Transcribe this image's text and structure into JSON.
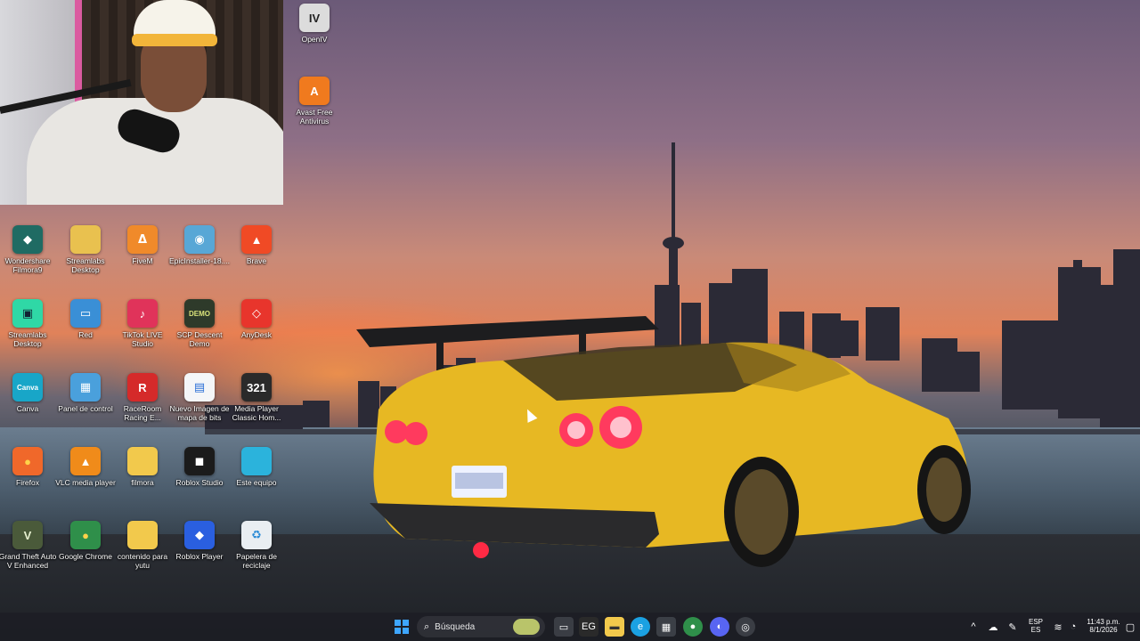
{
  "desktop_icons": [
    {
      "id": "openiv",
      "label": "OpenIV",
      "glyph": "IV",
      "color": "#dcdcdc",
      "text": "#222"
    },
    {
      "id": "avast",
      "label": "Avast Free Antivirus",
      "glyph": "A",
      "color": "#f07a1e",
      "text": "#fff"
    },
    {
      "id": "filmora",
      "label": "Wondershare Filmora9",
      "glyph": "◆",
      "color": "#1f6b63",
      "text": "#fff"
    },
    {
      "id": "streamlabs-desktop-folder",
      "label": "Streamlabs Desktop",
      "glyph": "",
      "color": "#e9c14f",
      "text": "#fff"
    },
    {
      "id": "fivem",
      "label": "FiveM",
      "glyph": "ᐃ",
      "color": "#f08a2a",
      "text": "#fff"
    },
    {
      "id": "epicinstaller",
      "label": "EpicInstaller-18....",
      "glyph": "◉",
      "color": "#58a7d6",
      "text": "#fff"
    },
    {
      "id": "brave",
      "label": "Brave",
      "glyph": "▲",
      "color": "#f04a25",
      "text": "#fff"
    },
    {
      "id": "streamlabs",
      "label": "Streamlabs Desktop",
      "glyph": "▣",
      "color": "#2fd8a6",
      "text": "#123"
    },
    {
      "id": "red",
      "label": "Red",
      "glyph": "▭",
      "color": "#3a8fd6",
      "text": "#fff"
    },
    {
      "id": "tiktok",
      "label": "TikTok LIVE Studio",
      "glyph": "♪",
      "color": "#e0335a",
      "text": "#fff"
    },
    {
      "id": "scp",
      "label": "SCP Descent Demo",
      "glyph": "DEMO",
      "color": "#2e3a2a",
      "text": "#d9e27a"
    },
    {
      "id": "anydesk",
      "label": "AnyDesk",
      "glyph": "◇",
      "color": "#e8352c",
      "text": "#fff"
    },
    {
      "id": "canva",
      "label": "Canva",
      "glyph": "Canva",
      "color": "#18a6c8",
      "text": "#fff"
    },
    {
      "id": "panel",
      "label": "Panel de control",
      "glyph": "▦",
      "color": "#4aa0dc",
      "text": "#fff"
    },
    {
      "id": "raceroom",
      "label": "RaceRoom Racing E...",
      "glyph": "R",
      "color": "#d52a2a",
      "text": "#fff"
    },
    {
      "id": "bitmap",
      "label": "Nuevo Imagen de mapa de bits",
      "glyph": "▤",
      "color": "#f4f6f8",
      "text": "#2a6fd6"
    },
    {
      "id": "mpc",
      "label": "Media Player Classic Hom...",
      "glyph": "321",
      "color": "#2a2a2a",
      "text": "#fff"
    },
    {
      "id": "firefox",
      "label": "Firefox",
      "glyph": "●",
      "color": "#f0682a",
      "text": "#ffd24a"
    },
    {
      "id": "vlc",
      "label": "VLC media player",
      "glyph": "▲",
      "color": "#f08b1a",
      "text": "#fff"
    },
    {
      "id": "filmora-folder",
      "label": "filmora",
      "glyph": "",
      "color": "#f2c94c",
      "text": "#fff"
    },
    {
      "id": "roblox-studio",
      "label": "Roblox Studio",
      "glyph": "◼",
      "color": "#1b1b1b",
      "text": "#fff"
    },
    {
      "id": "este-equipo",
      "label": "Este equipo",
      "glyph": "",
      "color": "#2bb3dc",
      "text": "#fff"
    },
    {
      "id": "gta",
      "label": "Grand Theft Auto V Enhanced",
      "glyph": "V",
      "color": "#4a5a3a",
      "text": "#e6f0d0"
    },
    {
      "id": "chrome",
      "label": "Google Chrome",
      "glyph": "●",
      "color": "#2f8f4a",
      "text": "#ffd24a"
    },
    {
      "id": "yutu-folder",
      "label": "contenido para yutu",
      "glyph": "",
      "color": "#f2c94c",
      "text": "#fff"
    },
    {
      "id": "roblox-player",
      "label": "Roblox Player",
      "glyph": "◆",
      "color": "#2a5fe0",
      "text": "#fff"
    },
    {
      "id": "papelera",
      "label": "Papelera de reciclaje",
      "glyph": "♻",
      "color": "#e9eef2",
      "text": "#2a8bd6"
    }
  ],
  "taskbar": {
    "search_placeholder": "Búsqueda",
    "language_top": "ESP",
    "language_bottom": "ES",
    "time": "11:43 p.m.",
    "date": "8/1/2026"
  }
}
